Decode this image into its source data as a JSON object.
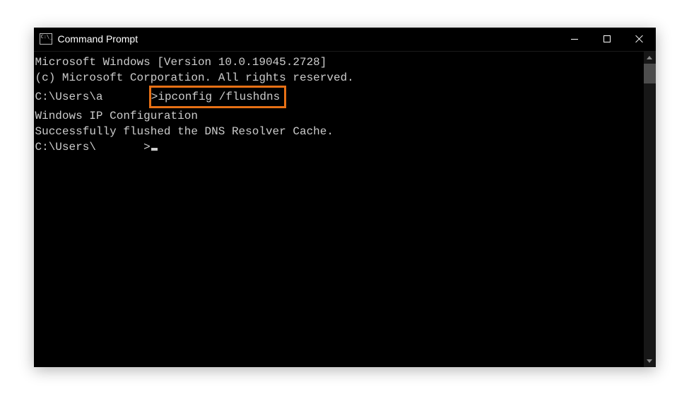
{
  "window": {
    "title": "Command Prompt"
  },
  "terminal": {
    "line1": "Microsoft Windows [Version 10.0.19045.2728]",
    "line2": "(c) Microsoft Corporation. All rights reserved.",
    "blank1": "",
    "prompt1_path": "C:\\Users\\a",
    "prompt1_sep": ">",
    "command1": "ipconfig /flushdns",
    "blank2": "",
    "output_header": "Windows IP Configuration",
    "blank3": "",
    "output_result": "Successfully flushed the DNS Resolver Cache.",
    "blank4": "",
    "prompt2_path": "C:\\Users\\",
    "prompt2_sep": ">"
  },
  "highlight": {
    "color": "#e67015"
  }
}
